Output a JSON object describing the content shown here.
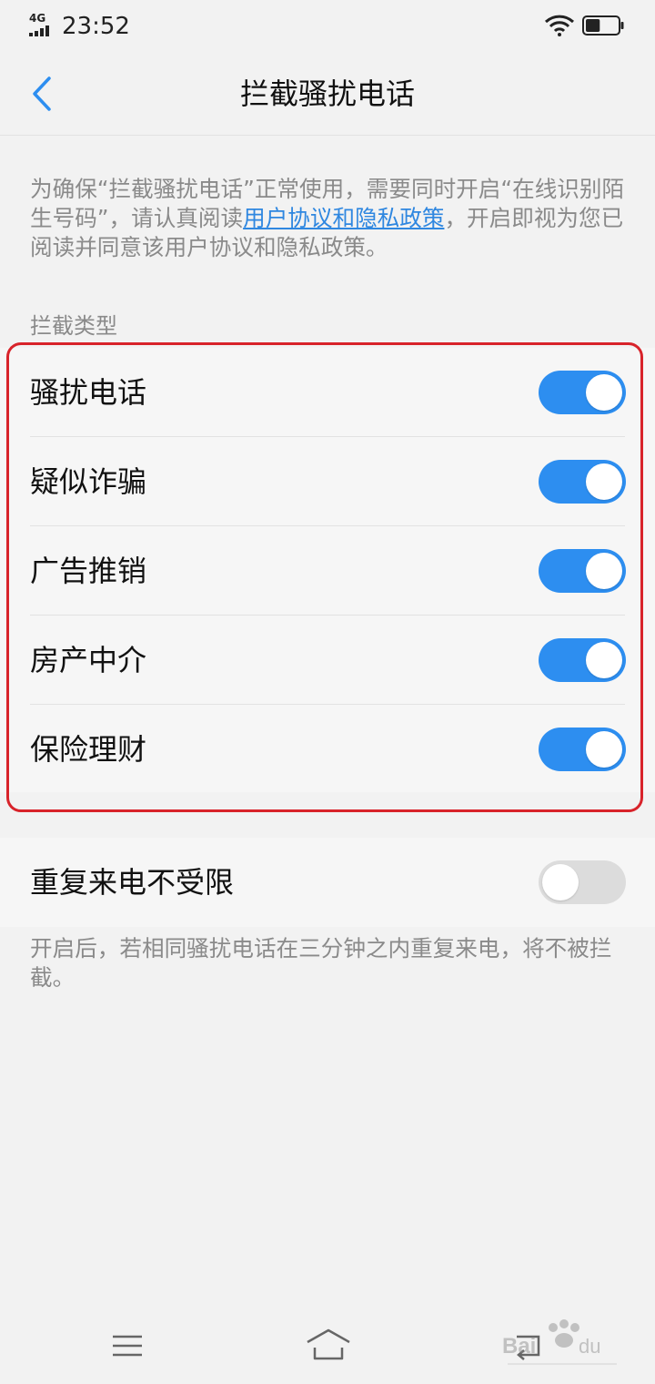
{
  "status_bar": {
    "network": "4G",
    "time": "23:52",
    "battery_level": 0.45
  },
  "header": {
    "title": "拦截骚扰电话",
    "back_icon": "chevron-left-icon"
  },
  "notice": {
    "text_before": "为确保“拦截骚扰电话”正常使用，需要同时开启“在线识别陌生号码”，请认真阅读",
    "link_text": "用户协议和隐私政策",
    "text_after": "，开启即视为您已阅读并同意该用户协议和隐私政策。"
  },
  "intercept_types": {
    "section_label": "拦截类型",
    "items": [
      {
        "label": "骚扰电话",
        "enabled": true
      },
      {
        "label": "疑似诈骗",
        "enabled": true
      },
      {
        "label": "广告推销",
        "enabled": true
      },
      {
        "label": "房产中介",
        "enabled": true
      },
      {
        "label": "保险理财",
        "enabled": true
      }
    ]
  },
  "repeat_call": {
    "label": "重复来电不受限",
    "enabled": false,
    "description": "开启后，若相同骚扰电话在三分钟之内重复来电，将不被拦截。"
  },
  "nav_bar": {
    "icons": [
      "menu-icon",
      "home-icon",
      "back-icon"
    ]
  },
  "colors": {
    "accent": "#2d8ef0",
    "link": "#2f87e0",
    "highlight": "#d8232a"
  }
}
